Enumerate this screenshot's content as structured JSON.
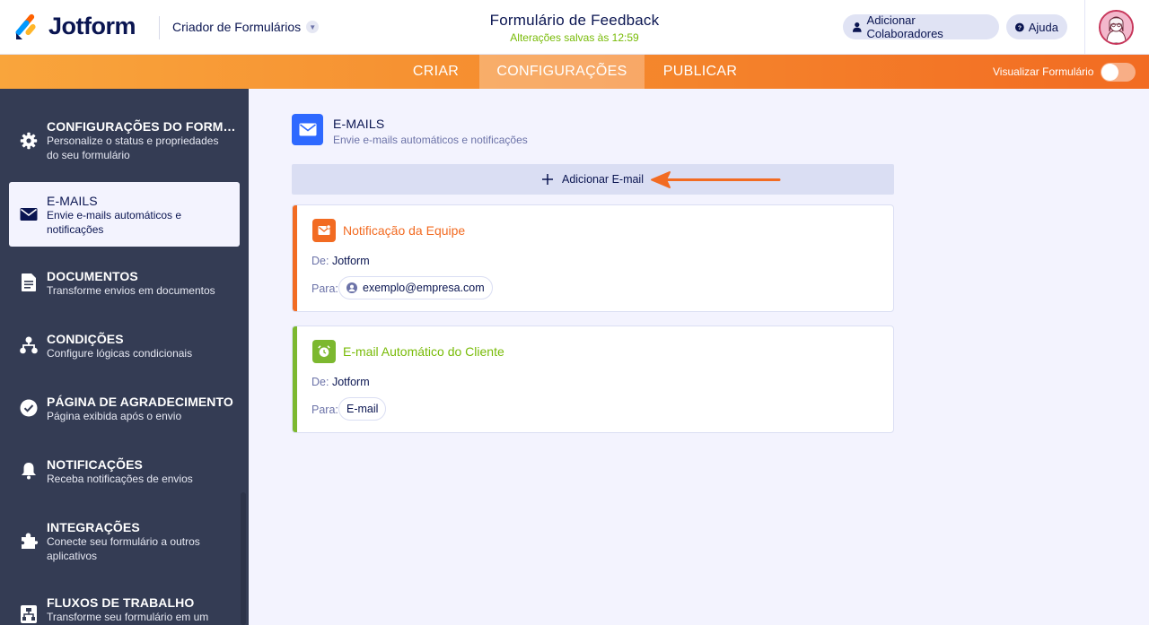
{
  "header": {
    "brand": "Jotform",
    "builder_title": "Criador de Formulários",
    "form_title": "Formulário de Feedback",
    "save_status": "Alterações salvas às 12:59",
    "add_collaborators": "Adicionar Colaboradores",
    "help": "Ajuda"
  },
  "nav": {
    "tabs": [
      {
        "label": "CRIAR"
      },
      {
        "label": "CONFIGURAÇÕES"
      },
      {
        "label": "PUBLICAR"
      }
    ],
    "active_tab": "CONFIGURAÇÕES",
    "preview_label": "Visualizar Formulário",
    "preview_enabled": false
  },
  "sidebar": {
    "items": [
      {
        "title": "CONFIGURAÇÕES DO FORM…",
        "desc": "Personalize o status e propriedades do seu formulário",
        "icon": "gear-icon"
      },
      {
        "title": "E-MAILS",
        "desc": "Envie e-mails automáticos e notificações",
        "icon": "envelope-icon"
      },
      {
        "title": "DOCUMENTOS",
        "desc": "Transforme envios em documentos",
        "icon": "document-icon"
      },
      {
        "title": "CONDIÇÕES",
        "desc": "Configure lógicas condicionais",
        "icon": "sitemap-icon"
      },
      {
        "title": "PÁGINA DE AGRADECIMENTO",
        "desc": "Página exibida após o envio",
        "icon": "check-circle-icon"
      },
      {
        "title": "NOTIFICAÇÕES",
        "desc": "Receba notificações de envios",
        "icon": "bell-icon"
      },
      {
        "title": "INTEGRAÇÕES",
        "desc": "Conecte seu formulário a outros aplicativos",
        "icon": "puzzle-icon"
      },
      {
        "title": "FLUXOS DE TRABALHO",
        "desc": "Transforme seu formulário em um",
        "icon": "workflow-icon"
      }
    ],
    "active_index": 1
  },
  "main": {
    "section_title": "E-MAILS",
    "section_subtitle": "Envie e-mails automáticos e notificações",
    "add_email": "Adicionar E-mail",
    "from_label": "De:",
    "to_label": "Para:",
    "cards": [
      {
        "title": "Notificação da Equipe",
        "from": "Jotform",
        "to": "exemplo@empresa.com",
        "color": "#f26b22",
        "icon": "mail-notification-icon"
      },
      {
        "title": "E-mail Automático do Cliente",
        "from": "Jotform",
        "to": "E-mail",
        "color": "#7cb82f",
        "icon": "alarm-clock-icon"
      }
    ]
  },
  "colors": {
    "accent_orange": "#f58a2e",
    "sidebar_bg": "#343c54",
    "primary_blue": "#2e69ff",
    "success_green": "#78bb07"
  }
}
